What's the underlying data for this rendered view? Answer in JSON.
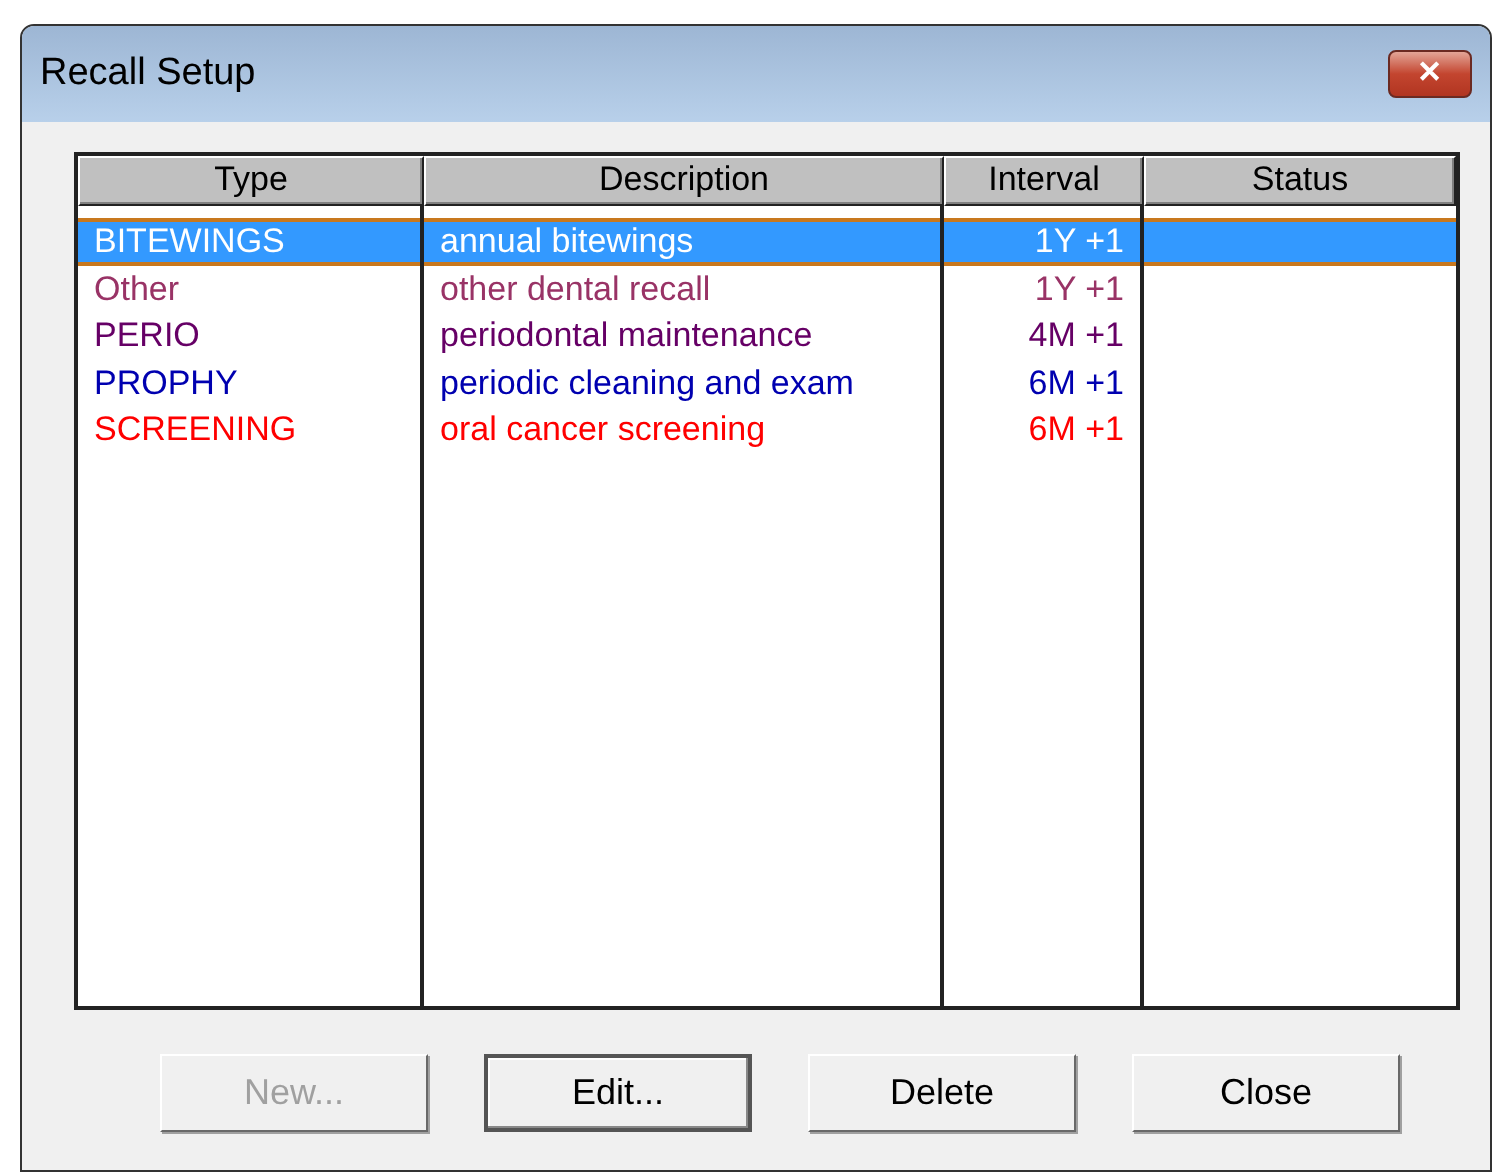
{
  "window": {
    "title": "Recall Setup",
    "close": "✕"
  },
  "table": {
    "columns": [
      "Type",
      "Description",
      "Interval",
      "Status"
    ],
    "rows": [
      {
        "type": "BITEWINGS",
        "description": "annual bitewings",
        "interval": "1Y +1",
        "selected": true
      },
      {
        "type": "Other",
        "description": "other dental recall",
        "interval": "1Y +1",
        "selected": false,
        "color": "#993366"
      },
      {
        "type": "PERIO",
        "description": "periodontal maintenance",
        "interval": "4M +1",
        "selected": false,
        "color": "#660066"
      },
      {
        "type": "PROPHY",
        "description": "periodic cleaning and exam",
        "interval": "6M +1",
        "selected": false,
        "color": "#0000b0"
      },
      {
        "type": "SCREENING",
        "description": "oral cancer screening",
        "interval": "6M +1",
        "selected": false,
        "color": "#ff0000"
      }
    ]
  },
  "buttons": [
    {
      "label": "New...",
      "disabled": true,
      "default": false
    },
    {
      "label": "Edit...",
      "disabled": false,
      "default": true
    },
    {
      "label": "Delete",
      "disabled": false,
      "default": false
    },
    {
      "label": "Close",
      "disabled": false,
      "default": false
    }
  ]
}
